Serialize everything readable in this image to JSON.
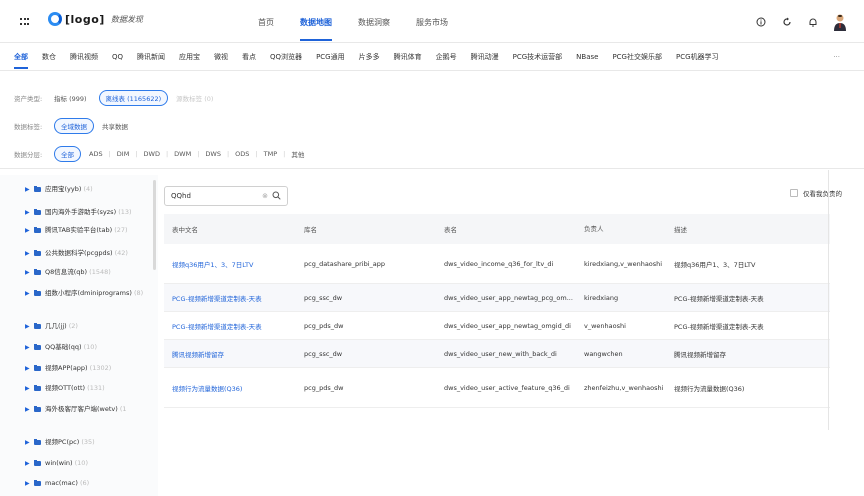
{
  "header": {
    "logo_text": "[logo]",
    "logo_sub": "数据发现",
    "nav": [
      {
        "label": "首页",
        "active": false
      },
      {
        "label": "数据地图",
        "active": true
      },
      {
        "label": "数据洞察",
        "active": false
      },
      {
        "label": "服务市场",
        "active": false
      }
    ],
    "icons": [
      "info-icon",
      "refresh-icon",
      "bell-icon",
      "avatar"
    ]
  },
  "category_tabs": {
    "items": [
      "全部",
      "数仓",
      "腾讯视频",
      "QQ",
      "腾讯新闻",
      "应用宝",
      "微视",
      "看点",
      "QQ浏览器",
      "PCG通用",
      "片多多",
      "腾讯体育",
      "企鹅号",
      "腾讯动漫",
      "PCG技术运营部",
      "NBase",
      "PCG社交娱乐部",
      "PCG机器学习"
    ],
    "more": "···"
  },
  "filters": {
    "asset_type": {
      "label": "资产类型:",
      "options": [
        "指标 (999)",
        "离线表 (1165622)",
        "源数标签 (0)"
      ]
    },
    "data_tag": {
      "label": "数据标签:",
      "options": [
        "全域数据",
        "共享数据"
      ]
    },
    "data_layer": {
      "label": "数据分层:",
      "options": [
        "全部",
        "ADS",
        "DIM",
        "DWD",
        "DWM",
        "DWS",
        "ODS",
        "TMP",
        "其他"
      ]
    }
  },
  "tree": [
    {
      "label": "应用宝(yyb)",
      "count": "(4)"
    },
    {
      "label": "国内海外手游助手(syzs)",
      "count": "(13)"
    },
    {
      "label": "腾讯TAB实验平台(tab)",
      "count": "(27)"
    },
    {
      "label": "公共数据科学(pcgpds)",
      "count": "(42)"
    },
    {
      "label": "Q8信息流(qb)",
      "count": "(1548)"
    },
    {
      "label": "组数小程序(dminiprograms)",
      "count": "(8)"
    },
    {
      "label": "几几(jj)",
      "count": "(2)"
    },
    {
      "label": "QQ基础(qq)",
      "count": "(10)"
    },
    {
      "label": "视频APP(app)",
      "count": "(1302)"
    },
    {
      "label": "视频OTT(ott)",
      "count": "(131)"
    },
    {
      "label": "海外极客厅客户端(wetv)",
      "count": "(1"
    },
    {
      "label": "视频PC(pc)",
      "count": "(35)"
    },
    {
      "label": "win(win)",
      "count": "(10)"
    },
    {
      "label": "mac(mac)",
      "count": "(6)"
    }
  ],
  "search": {
    "value": "QQhd",
    "clear_icon": "clear-icon",
    "search_icon": "search-icon"
  },
  "only_mine": {
    "label": "仅看我负责的",
    "checked": false
  },
  "table": {
    "headers": [
      "表中文名",
      "库名",
      "表名",
      "负责人",
      "描述"
    ],
    "rows": [
      {
        "cn": "视频q36用户1、3、7日LTV",
        "db": "pcg_datashare_pribi_app",
        "table": "dws_video_income_q36_for_ltv_di",
        "owner": "kiredxiang,v_wenhaoshi",
        "desc": "视频q36用户1、3、7日LTV"
      },
      {
        "cn": "PCG-视频新增渠道定制表-天表",
        "db": "pcg_ssc_dw",
        "table": "dws_video_user_app_newtag_pcg_om...",
        "owner": "kiredxiang",
        "desc": "PCG-视频新增渠道定制表-天表"
      },
      {
        "cn": "PCG-视频新增渠道定制表-天表",
        "db": "pcg_pds_dw",
        "table": "dws_video_user_app_newtag_omgid_di",
        "owner": "v_wenhaoshi",
        "desc": "PCG-视频新增渠道定制表-天表"
      },
      {
        "cn": "腾讯视频新增留存",
        "db": "pcg_ssc_dw",
        "table": "dws_video_user_new_with_back_di",
        "owner": "wangwchen",
        "desc": "腾讯视频新增留存"
      },
      {
        "cn": "视频行为流量数据(Q36)",
        "db": "pcg_pds_dw",
        "table": "dws_video_user_active_feature_q36_di",
        "owner": "zhenfeizhu,v_wenhaoshi",
        "desc": "视频行为流量数据(Q36)"
      }
    ]
  },
  "colors": {
    "accent": "#1f63d9",
    "folder": "#2a67c9"
  }
}
